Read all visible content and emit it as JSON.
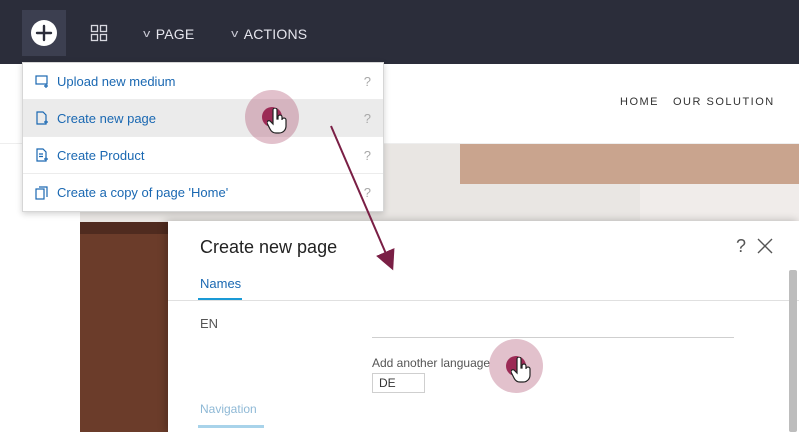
{
  "toolbar": {
    "add_icon": "plus-icon",
    "layout_icon": "grid-icon",
    "page_menu_label": "PAGE",
    "actions_menu_label": "ACTIONS"
  },
  "site": {
    "nav_home": "HOME",
    "nav_solutions": "OUR SOLUTION"
  },
  "dropdown": {
    "items": [
      {
        "label": "Upload new medium",
        "icon": "upload-icon",
        "help": "?"
      },
      {
        "label": "Create new page",
        "icon": "new-page-icon",
        "help": "?"
      },
      {
        "label": "Create Product",
        "icon": "product-icon",
        "help": "?"
      },
      {
        "label": "Create a copy of page 'Home'",
        "icon": "copy-icon",
        "help": "?"
      }
    ]
  },
  "modal": {
    "title": "Create new page",
    "help": "?",
    "tab_names": "Names",
    "language_label": "EN",
    "name_value": "",
    "add_language_label": "Add another language",
    "language_option": "DE",
    "tab_navigation": "Navigation"
  },
  "colors": {
    "toolbar_bg": "#2b2d3a",
    "link_blue": "#1a68b2",
    "tab_underline": "#1a9ad6",
    "click_indicator": "#9c2a55",
    "annotation_arrow": "#7a1f45"
  }
}
